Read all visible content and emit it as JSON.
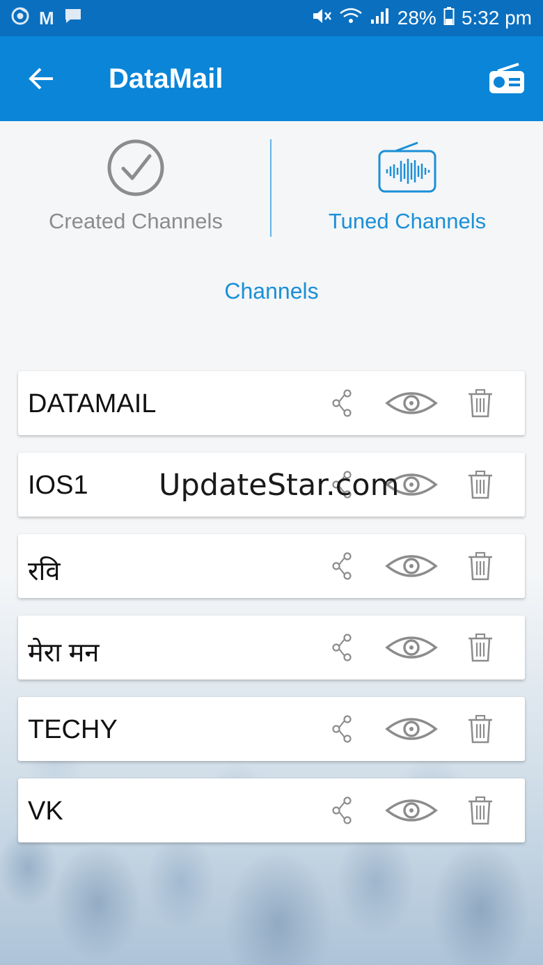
{
  "status_bar": {
    "battery": "28%",
    "time": "5:32 pm",
    "left_icons": [
      "chrome-icon",
      "m-icon",
      "message-icon"
    ],
    "right_icons": [
      "mute-icon",
      "wifi-icon",
      "signal-icon",
      "battery-icon"
    ]
  },
  "app_bar": {
    "title": "DataMail",
    "back_icon": "back-arrow-icon",
    "action_icon": "radio-icon"
  },
  "tabs": [
    {
      "label": "Created Channels",
      "icon": "check-circle-icon",
      "active": false
    },
    {
      "label": "Tuned Channels",
      "icon": "radio-wave-icon",
      "active": true
    }
  ],
  "section": {
    "label": "Channels"
  },
  "channels": [
    {
      "name": "DATAMAIL"
    },
    {
      "name": "IOS1"
    },
    {
      "name": "रवि"
    },
    {
      "name": "मेरा मन"
    },
    {
      "name": "TECHY"
    },
    {
      "name": "VK"
    }
  ],
  "row_actions": [
    "share-icon",
    "eye-icon",
    "trash-icon"
  ],
  "watermark": "UpdateStar.com",
  "colors": {
    "status_bar": "#0a6fbf",
    "app_bar": "#0a85d8",
    "accent": "#1b8fd6",
    "inactive": "#8c8c8c"
  }
}
